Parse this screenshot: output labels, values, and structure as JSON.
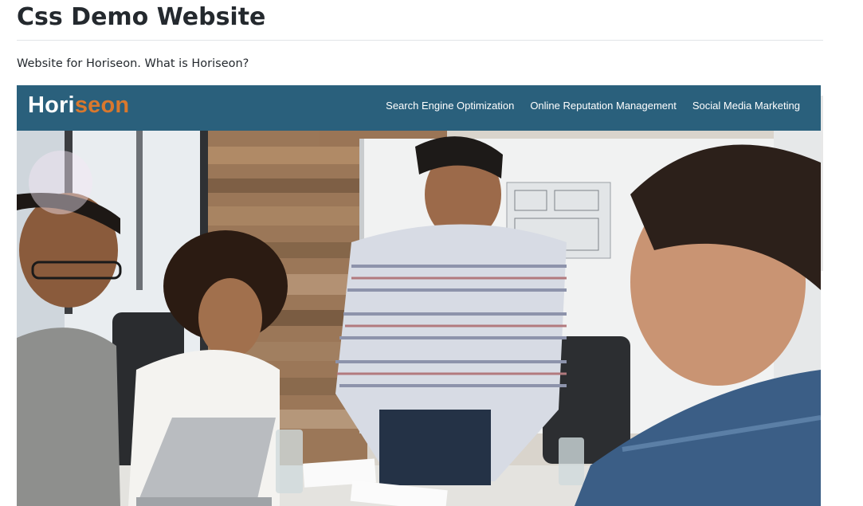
{
  "page": {
    "title": "Css Demo Website",
    "intro": "Website for Horiseon. What is Horiseon?"
  },
  "site": {
    "logo": {
      "part1": "Hori",
      "part2": "seon"
    },
    "nav": [
      {
        "label": "Search Engine Optimization"
      },
      {
        "label": "Online Reputation Management"
      },
      {
        "label": "Social Media Marketing"
      }
    ],
    "hero": {
      "icon": "team-meeting-photo"
    }
  },
  "colors": {
    "header_bg": "#2a607c",
    "logo_accent": "#d9782d",
    "nav_text": "#ffffff"
  }
}
